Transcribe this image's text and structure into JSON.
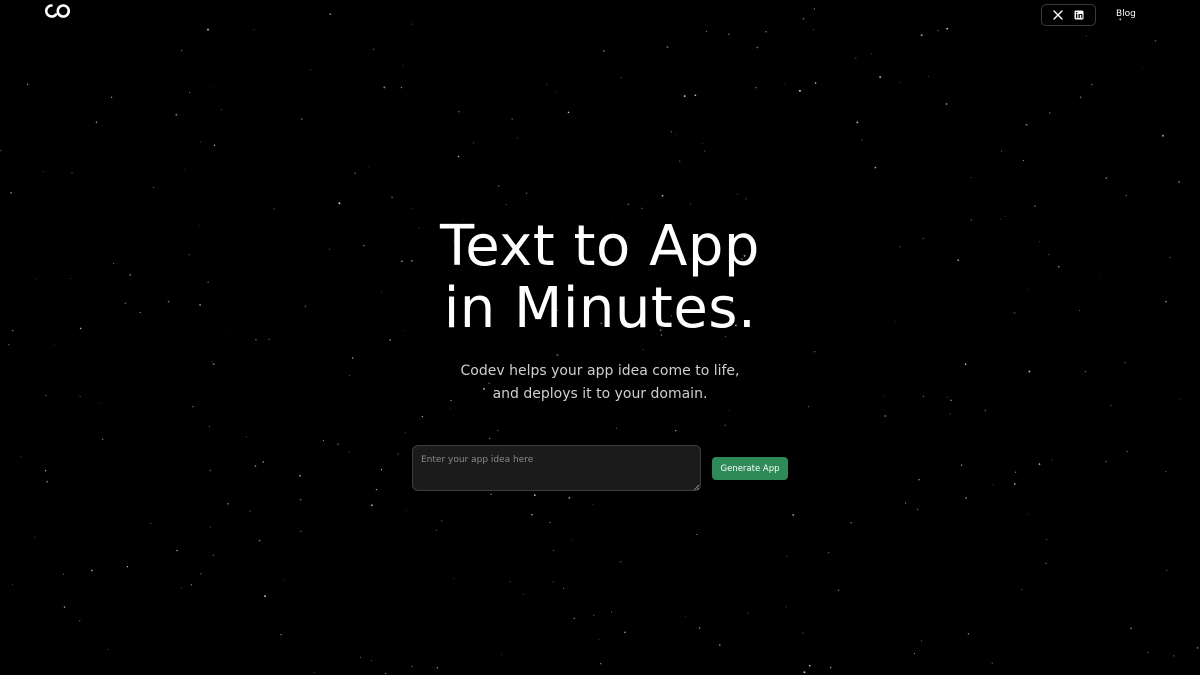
{
  "header": {
    "logo_icon": "codev-infinity-logo-icon",
    "social": [
      {
        "icon": "x-twitter-icon"
      },
      {
        "icon": "linkedin-icon"
      }
    ],
    "blog_label": "Blog"
  },
  "hero": {
    "title_line1": "Text to App",
    "title_line2": "in Minutes.",
    "subtitle_line1": "Codev helps your app idea come to life,",
    "subtitle_line2": "and deploys it to your domain."
  },
  "form": {
    "input_placeholder": "Enter your app idea here",
    "input_value": "",
    "submit_label": "Generate App"
  },
  "colors": {
    "background": "#000000",
    "accent": "#2e8a57",
    "text": "#ffffff",
    "muted_text": "#cfcfcf"
  }
}
